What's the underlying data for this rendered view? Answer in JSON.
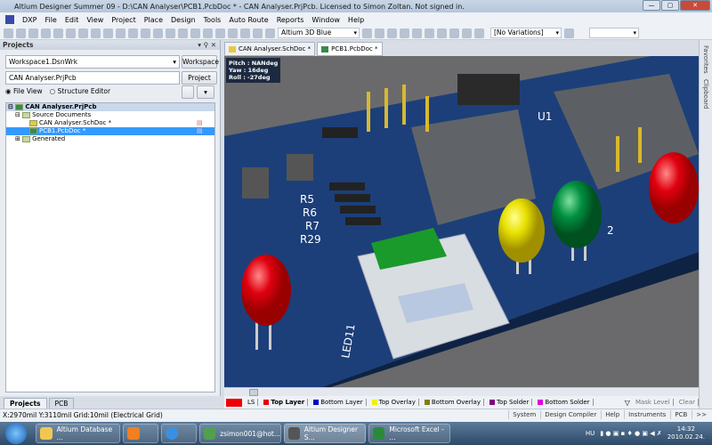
{
  "title": "Altium Designer Summer 09 - D:\\CAN Analyser\\PCB1.PcbDoc * - CAN Analyser.PrjPcb. Licensed to Simon Zoltan. Not signed in.",
  "menu": [
    "DXP",
    "File",
    "Edit",
    "View",
    "Project",
    "Place",
    "Design",
    "Tools",
    "Auto Route",
    "Reports",
    "Window",
    "Help"
  ],
  "toolbar": {
    "view_config": "Altium 3D Blue",
    "variations": "[No Variations]",
    "extra": ""
  },
  "panel": {
    "title": "Projects",
    "workspace_value": "Workspace1.DsnWrk",
    "workspace_btn": "Workspace",
    "project_value": "CAN Analyser.PrjPcb",
    "project_btn": "Project",
    "radio_file_view": "File View",
    "radio_structure": "Structure Editor",
    "tree": [
      {
        "label": "CAN Analyser.PrjPcb",
        "level": 0
      },
      {
        "label": "Source Documents",
        "level": 1
      },
      {
        "label": "CAN Analyser.SchDoc *",
        "level": 2
      },
      {
        "label": "PCB1.PcbDoc *",
        "level": 2,
        "selected": true
      },
      {
        "label": "Generated",
        "level": 1
      }
    ],
    "tabs": [
      "Projects",
      "PCB"
    ]
  },
  "doc_tabs": [
    "CAN Analyser.SchDoc *",
    "PCB1.PcbDoc *"
  ],
  "hud": {
    "pitch": "Pitch : NANdeg",
    "yaw": "Yaw : 16deg",
    "roll": "Roll : -27deg"
  },
  "board_labels": [
    "R5",
    "R6",
    "R7",
    "R29",
    "U1",
    "LED11",
    "2"
  ],
  "layers": {
    "ls": "LS",
    "items": [
      {
        "name": "Top Layer",
        "color": "#e00000"
      },
      {
        "name": "Bottom Layer",
        "color": "#0000c8"
      },
      {
        "name": "Top Overlay",
        "color": "#f0f000"
      },
      {
        "name": "Bottom Overlay",
        "color": "#808000"
      },
      {
        "name": "Top Solder",
        "color": "#800080"
      },
      {
        "name": "Bottom Solder",
        "color": "#e000e0"
      }
    ],
    "mask_level": "Mask Level",
    "clear": "Clear"
  },
  "right_strip": [
    "Favorites",
    "Clipboard"
  ],
  "status": {
    "coords": "X:2970mil Y:3110mil   Grid:10mil    (Electrical Grid)",
    "buttons": [
      "System",
      "Design Compiler",
      "Help",
      "Instruments",
      "PCB",
      ">>"
    ]
  },
  "taskbar": {
    "items": [
      "Altium Database ...",
      "",
      "",
      "zsimon001@hot...",
      "Altium Designer S...",
      "Microsoft Excel - ..."
    ],
    "lang": "HU",
    "time": "14:32",
    "date": "2010.02.24."
  }
}
